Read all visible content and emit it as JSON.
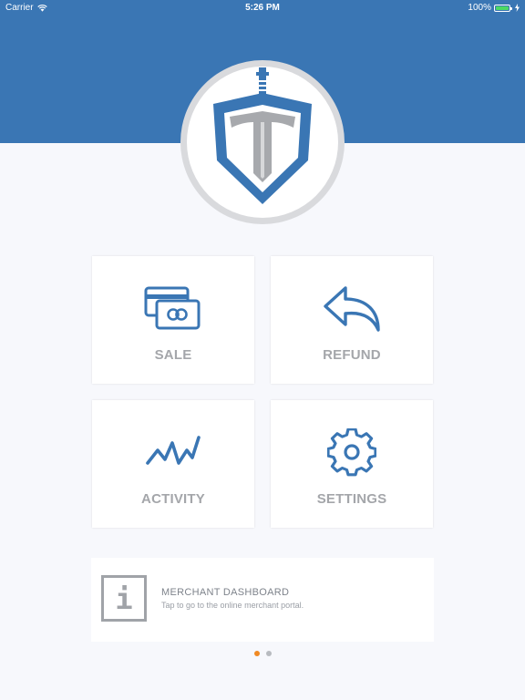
{
  "status_bar": {
    "carrier": "Carrier",
    "time": "5:26 PM",
    "battery": "100%"
  },
  "colors": {
    "header": "#3a76b4",
    "icon_blue": "#3a76b4",
    "label_gray": "#a4a6aa",
    "pager_active": "#f08a24",
    "pager_inactive": "#b8bbc0"
  },
  "tiles": [
    {
      "label": "SALE",
      "icon": "credit-card-icon"
    },
    {
      "label": "REFUND",
      "icon": "reply-arrow-icon"
    },
    {
      "label": "ACTIVITY",
      "icon": "activity-line-icon"
    },
    {
      "label": "SETTINGS",
      "icon": "gear-icon"
    }
  ],
  "merchant": {
    "title": "MERCHANT DASHBOARD",
    "subtitle": "Tap to go to the online merchant portal.",
    "icon": "info-icon"
  },
  "pager": {
    "pages": 2,
    "active": 0
  }
}
